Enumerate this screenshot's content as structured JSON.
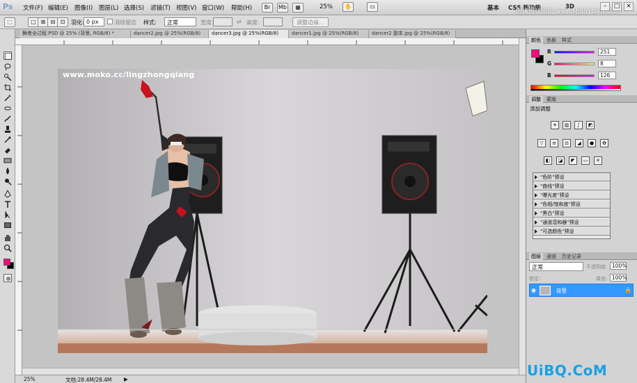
{
  "app": {
    "logo": "Ps"
  },
  "menus": [
    "文件(F)",
    "编辑(E)",
    "图像(I)",
    "图层(L)",
    "选择(S)",
    "滤镜(T)",
    "视图(V)",
    "窗口(W)",
    "帮助(H)"
  ],
  "menubar": {
    "zoom": "25%",
    "workspace_basic": "基本",
    "workspace_cs5": "CS5 新功能",
    "workspace_3d": "3D",
    "window_min": "–",
    "window_max": "□",
    "window_close": "×"
  },
  "options": {
    "feather_label": "羽化:",
    "feather_value": "0 px",
    "antialias_label": "消除锯齿",
    "style_label": "样式:",
    "style_value": "正常",
    "width_label": "宽度:",
    "height_label": "高度:",
    "refine_edge": "调整边缘..."
  },
  "tabs": [
    "舞者全过程.PSD @ 25% (背景, RGB/8) *",
    "dancer2.jpg @ 25%(RGB/8)",
    "dancer3.jpg @ 25%(RGB/8)",
    "dancer1.jpg @ 25%(RGB/8)",
    "dancer2 副本.jpg @ 25%(RGB/8)"
  ],
  "photo": {
    "watermark": "www.moko.cc/lingzhongqiang"
  },
  "status": {
    "zoom": "25%",
    "doc": "文档:28.4M/28.4M"
  },
  "panels": {
    "color_tabs": [
      "颜色",
      "色板",
      "样式"
    ],
    "color": {
      "r_label": "R",
      "r_value": "251",
      "g_label": "G",
      "g_value": "8",
      "b_label": "B",
      "b_value": "126",
      "foreground": "#fb087e",
      "background": "#000000"
    },
    "adjust_tabs": [
      "调整",
      "蒙版"
    ],
    "adjust_title": "添加调整",
    "presets": [
      "\"色阶\"预设",
      "\"曲线\"预设",
      "\"曝光度\"预设",
      "\"色相/饱和度\"预设",
      "\"黑白\"预设",
      "\"通道混和器\"预设",
      "\"可选颜色\"预设"
    ],
    "layers_tabs": [
      "图层",
      "通道",
      "历史记录"
    ],
    "layers": {
      "blend_mode": "正常",
      "opacity_label": "不透明度:",
      "opacity": "100%",
      "lock_label": "锁定:",
      "fill_label": "填充:",
      "fill": "100%",
      "layer_name": "背景"
    }
  },
  "overlay": {
    "site_watermark": "思缘设计论坛 www.MISSYUAN.COM",
    "uibq": "UiBQ.CoM"
  }
}
